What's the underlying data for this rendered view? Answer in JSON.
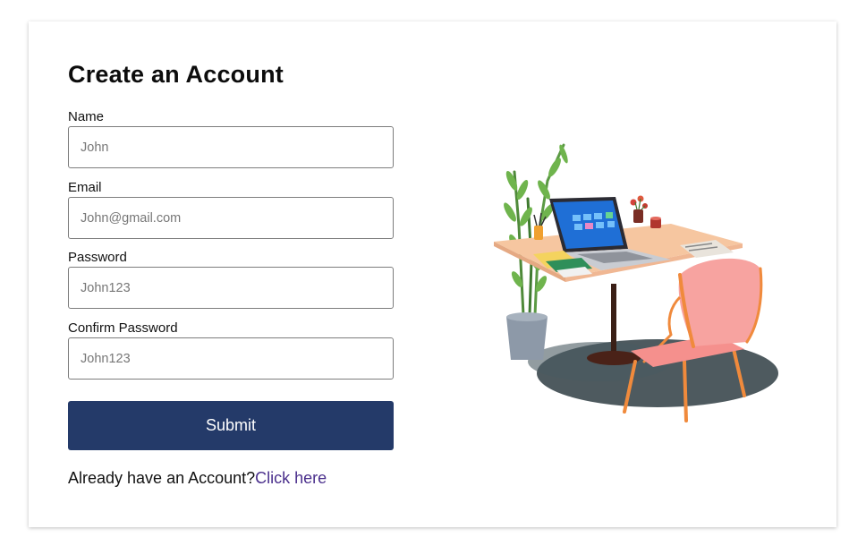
{
  "form": {
    "title": "Create an Account",
    "fields": [
      {
        "label": "Name",
        "placeholder": "John"
      },
      {
        "label": "Email",
        "placeholder": "John@gmail.com"
      },
      {
        "label": "Password",
        "placeholder": "John123"
      },
      {
        "label": "Confirm Password",
        "placeholder": "John123"
      }
    ],
    "submit_label": "Submit",
    "login_prompt": "Already have an Account?",
    "login_link": "Click here"
  },
  "colors": {
    "button": "#243a69",
    "link": "#4a2f8c",
    "input_border": "#7d7d7d"
  }
}
